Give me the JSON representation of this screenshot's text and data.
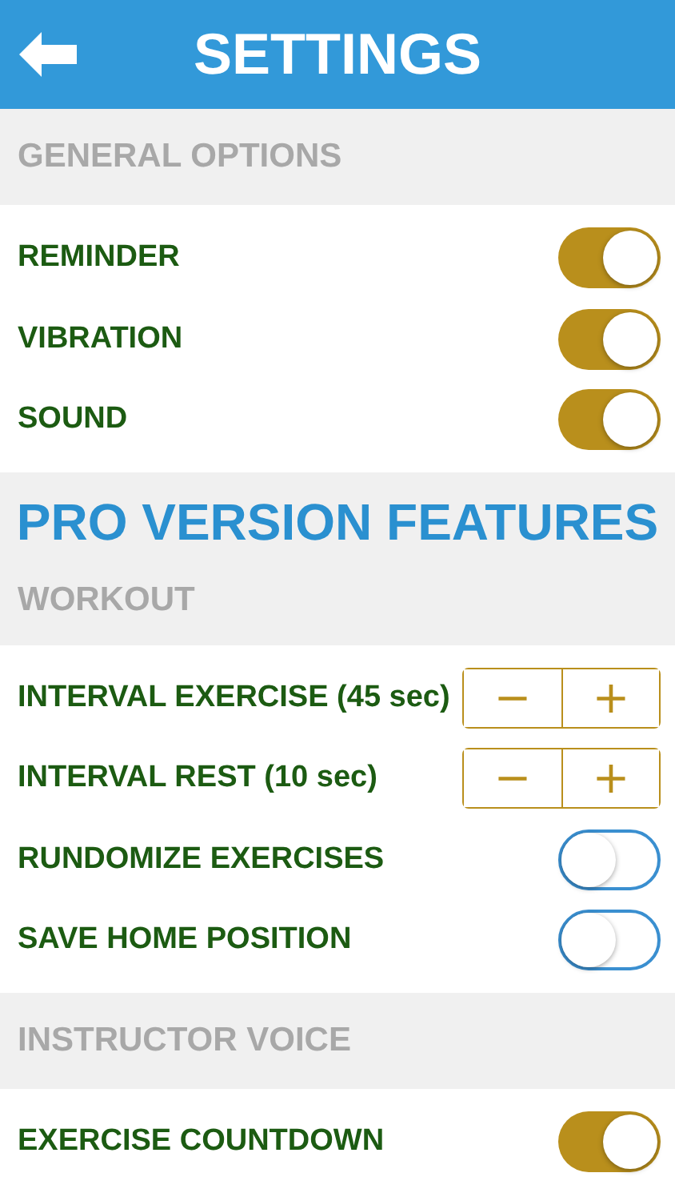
{
  "header": {
    "title": "SETTINGS"
  },
  "groups": [
    {
      "heading": "GENERAL OPTIONS",
      "rows": [
        {
          "label": "REMINDER",
          "kind": "toggle",
          "on": true
        },
        {
          "label": "VIBRATION",
          "kind": "toggle",
          "on": true
        },
        {
          "label": "SOUND",
          "kind": "toggle",
          "on": true
        }
      ]
    },
    {
      "banner": "PRO VERSION FEATURES",
      "heading": "WORKOUT",
      "rows": [
        {
          "label": "INTERVAL EXERCISE (45 sec)",
          "kind": "stepper",
          "minus": "−",
          "plus": "+"
        },
        {
          "label": "INTERVAL REST (10 sec)",
          "kind": "stepper",
          "minus": "−",
          "plus": "+"
        },
        {
          "label": "RUNDOMIZE EXERCISES",
          "kind": "toggle",
          "on": false
        },
        {
          "label": "SAVE HOME POSITION",
          "kind": "toggle",
          "on": false
        }
      ]
    },
    {
      "heading": "INSTRUCTOR VOICE",
      "rows": [
        {
          "label": "EXERCISE COUNTDOWN",
          "kind": "toggle",
          "on": true
        }
      ]
    }
  ]
}
